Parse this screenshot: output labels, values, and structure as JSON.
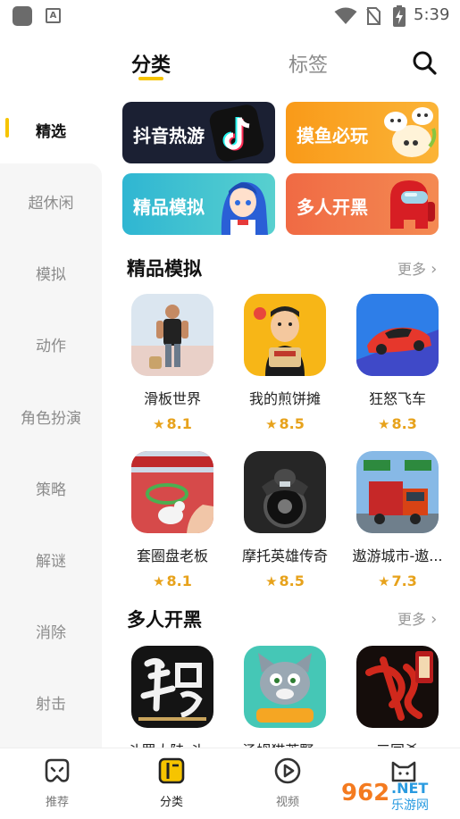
{
  "status_bar": {
    "time": "5:39",
    "badge_letter": "A"
  },
  "top_tabs": [
    {
      "label": "分类",
      "active": true
    },
    {
      "label": "标签",
      "active": false
    }
  ],
  "sidebar": {
    "items": [
      {
        "label": "精选",
        "active": true
      },
      {
        "label": "超休闲"
      },
      {
        "label": "模拟"
      },
      {
        "label": "动作"
      },
      {
        "label": "角色扮演"
      },
      {
        "label": "策略"
      },
      {
        "label": "解谜"
      },
      {
        "label": "消除"
      },
      {
        "label": "射击"
      }
    ]
  },
  "category_cards": [
    {
      "label": "抖音热游",
      "color": "#1b2033"
    },
    {
      "label": "摸鱼必玩",
      "color": "#f7a21c"
    },
    {
      "label": "精品模拟",
      "color": "#35c2cf"
    },
    {
      "label": "多人开黑",
      "color": "#f26a46"
    }
  ],
  "sections": [
    {
      "title": "精品模拟",
      "more": "更多",
      "games": [
        {
          "name": "滑板世界",
          "rating": "8.1",
          "icon": "skateboard-character-icon"
        },
        {
          "name": "我的煎饼摊",
          "rating": "8.5",
          "icon": "pancake-vendor-icon"
        },
        {
          "name": "狂怒飞车",
          "rating": "8.3",
          "icon": "red-sports-car-icon"
        },
        {
          "name": "套圈盘老板",
          "rating": "8.1",
          "icon": "ring-toss-icon"
        },
        {
          "name": "摩托英雄传奇",
          "rating": "8.5",
          "icon": "motorcycle-icon"
        },
        {
          "name": "遨游城市-遨...",
          "rating": "7.3",
          "icon": "truck-icon"
        }
      ]
    },
    {
      "title": "多人开黑",
      "more": "更多",
      "games": [
        {
          "name": "斗罗大陆-斗...",
          "icon": "douluo-calligraphy-icon"
        },
        {
          "name": "汤姆猫荒野...",
          "icon": "talking-tom-icon"
        },
        {
          "name": "三国杀",
          "icon": "sanguosha-calligraphy-icon"
        }
      ]
    }
  ],
  "bottom_nav": [
    {
      "label": "推荐",
      "icon": "gamepad-icon",
      "active": false
    },
    {
      "label": "分类",
      "icon": "category-icon",
      "active": true
    },
    {
      "label": "视频",
      "icon": "play-icon",
      "active": false
    },
    {
      "label": "",
      "icon": "cat-icon",
      "active": false
    }
  ],
  "colors": {
    "accent": "#f6c400",
    "rating": "#e7a21b"
  }
}
